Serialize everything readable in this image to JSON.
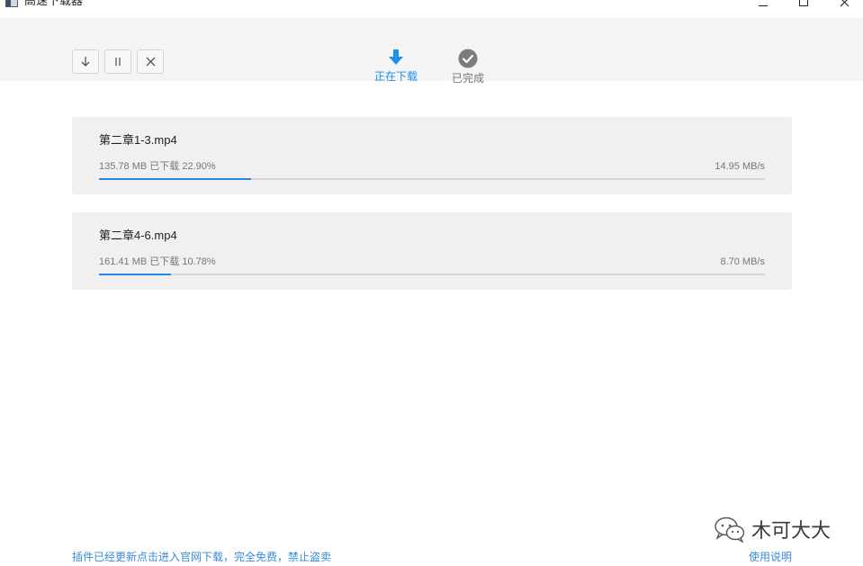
{
  "window": {
    "title": "高速下载器",
    "minimize_icon": "minimize-icon",
    "maximize_icon": "maximize-icon",
    "close_icon": "close-icon"
  },
  "toolbar": {
    "controls": [
      {
        "name": "download-all-button",
        "icon": "arrow-down-icon"
      },
      {
        "name": "pause-all-button",
        "icon": "pause-icon"
      },
      {
        "name": "cancel-all-button",
        "icon": "close-icon"
      }
    ],
    "tabs": [
      {
        "label": "正在下载",
        "icon": "download-arrow-icon",
        "active": true
      },
      {
        "label": "已完成",
        "icon": "check-circle-icon",
        "active": false
      }
    ]
  },
  "downloads": [
    {
      "file_name": "第二章1-3.mp4",
      "size": "135.78 MB",
      "status_label": "已下载",
      "percent": "22.90%",
      "speed": "14.95 MB/s",
      "progress": 0.229
    },
    {
      "file_name": "第二章4-6.mp4",
      "size": "161.41 MB",
      "status_label": "已下载",
      "percent": "10.78%",
      "speed": "8.70 MB/s",
      "progress": 0.1078
    }
  ],
  "footer": {
    "notice": "插件已经更新点击进入官网下载，完全免费，禁止盗卖",
    "help": "使用说明"
  },
  "watermark": {
    "text": "木可大大",
    "icon": "wechat-icon"
  },
  "colors": {
    "accent": "#1e90e8",
    "progress": "#2188e3",
    "link": "#3b8bd6"
  }
}
